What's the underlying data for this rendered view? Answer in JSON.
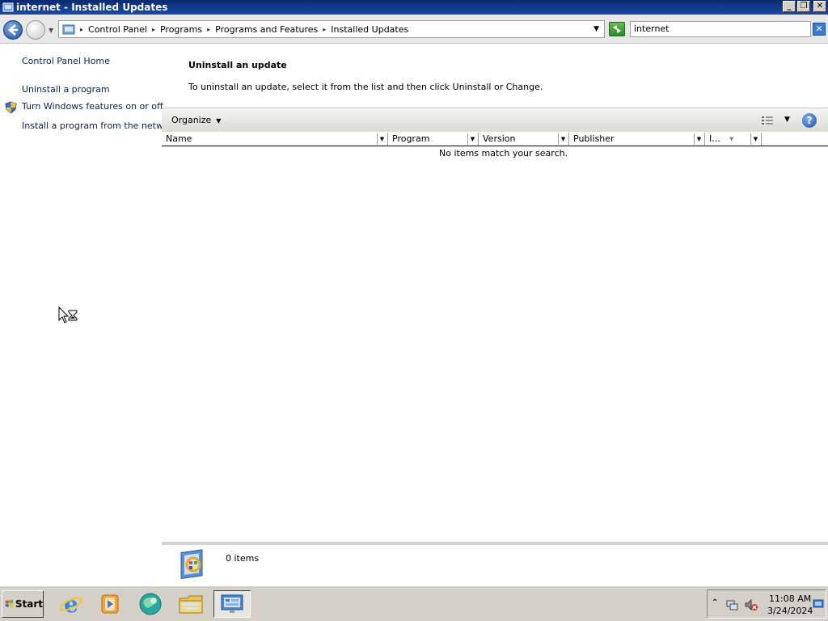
{
  "window": {
    "title": "internet - Installed Updates"
  },
  "address_bar": {
    "breadcrumbs": [
      "Control Panel",
      "Programs",
      "Programs and Features",
      "Installed Updates"
    ]
  },
  "search": {
    "value": "internet"
  },
  "left_pane": {
    "links": [
      "Control Panel Home",
      "Uninstall a program",
      "Turn Windows features on or off",
      "Install a program from the network"
    ]
  },
  "main": {
    "heading": "Uninstall an update",
    "description": "To uninstall an update, select it from the list and then click Uninstall or Change."
  },
  "toolbar": {
    "organize_label": "Organize"
  },
  "columns": [
    "Name",
    "Program",
    "Version",
    "Publisher",
    "I..."
  ],
  "list": {
    "empty_message": "No items match your search."
  },
  "details": {
    "count_label": "0 items"
  },
  "taskbar": {
    "start_label": "Start",
    "apps": [
      "internet-explorer-icon",
      "media-player-icon",
      "network-globe-icon",
      "file-explorer-icon",
      "control-panel-icon"
    ],
    "clock_time": "11:08 AM",
    "clock_date": "3/24/2024"
  }
}
